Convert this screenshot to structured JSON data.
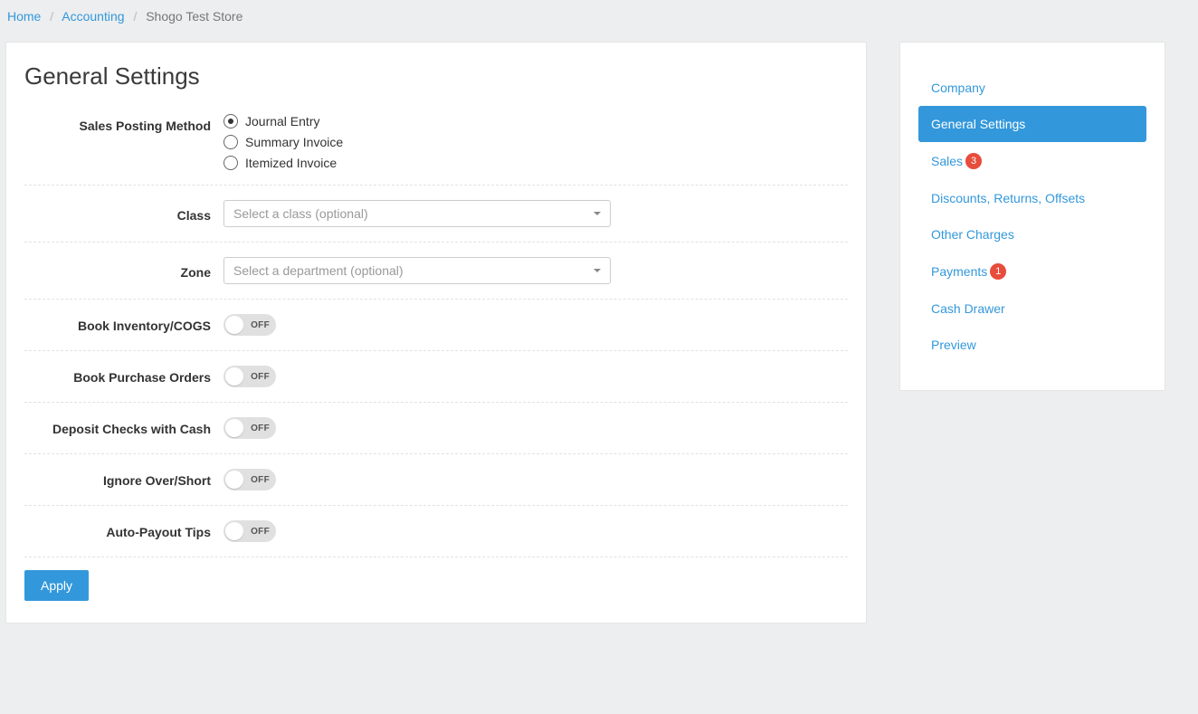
{
  "breadcrumb": {
    "home": "Home",
    "accounting": "Accounting",
    "store": "Shogo Test Store"
  },
  "page_title": "General Settings",
  "form": {
    "sales_posting_method": {
      "label": "Sales Posting Method",
      "options": {
        "journal_entry": "Journal Entry",
        "summary_invoice": "Summary Invoice",
        "itemized_invoice": "Itemized Invoice"
      },
      "selected": "journal_entry"
    },
    "class": {
      "label": "Class",
      "placeholder": "Select a class (optional)"
    },
    "zone": {
      "label": "Zone",
      "placeholder": "Select a department (optional)"
    },
    "book_inventory": {
      "label": "Book Inventory/COGS",
      "value_text": "OFF"
    },
    "book_po": {
      "label": "Book Purchase Orders",
      "value_text": "OFF"
    },
    "deposit_checks": {
      "label": "Deposit Checks with Cash",
      "value_text": "OFF"
    },
    "ignore_over_short": {
      "label": "Ignore Over/Short",
      "value_text": "OFF"
    },
    "auto_payout_tips": {
      "label": "Auto-Payout Tips",
      "value_text": "OFF"
    },
    "apply_label": "Apply"
  },
  "sidebar": {
    "items": [
      {
        "label": "Company",
        "badge": null,
        "active": false
      },
      {
        "label": "General Settings",
        "badge": null,
        "active": true
      },
      {
        "label": "Sales",
        "badge": "3",
        "active": false
      },
      {
        "label": "Discounts, Returns, Offsets",
        "badge": null,
        "active": false
      },
      {
        "label": "Other Charges",
        "badge": null,
        "active": false
      },
      {
        "label": "Payments",
        "badge": "1",
        "active": false
      },
      {
        "label": "Cash Drawer",
        "badge": null,
        "active": false
      },
      {
        "label": "Preview",
        "badge": null,
        "active": false
      }
    ]
  }
}
